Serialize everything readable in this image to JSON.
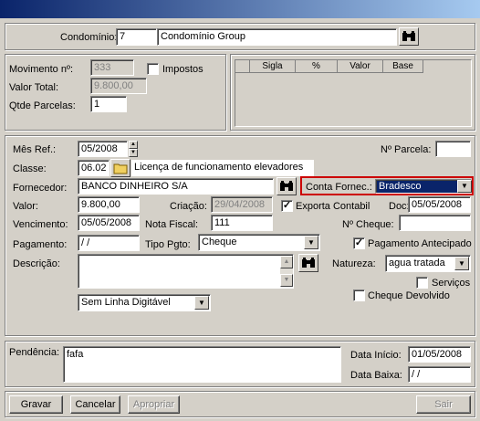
{
  "header": {
    "condominio_label": "Condomínio:",
    "condominio_code": "7",
    "condominio_name": "Condomínio Group",
    "search_icon": "binoculars-icon"
  },
  "movimento": {
    "movimento_label": "Movimento nº:",
    "movimento_value": "333",
    "impostos_label": "Impostos",
    "valor_total_label": "Valor Total:",
    "valor_total_value": "9.800,00",
    "parcelas_label": "Qtde Parcelas:",
    "parcelas_value": "1",
    "grid_columns": [
      "Sigla",
      "%",
      "Valor",
      "Base"
    ]
  },
  "detail": {
    "mes_ref_label": "Mês Ref.:",
    "mes_ref_value": "05/2008",
    "parcela_label": "Nº Parcela:",
    "parcela_value": "",
    "classe_label": "Classe:",
    "classe_code": "06.02",
    "classe_desc": "Licença de funcionamento elevadores",
    "fornecedor_label": "Fornecedor:",
    "fornecedor_value": "BANCO DINHEIRO S/A",
    "conta_label": "Conta Fornec.:",
    "conta_value": "Bradesco",
    "valor_label": "Valor:",
    "valor_value": "9.800,00",
    "criacao_label": "Criação:",
    "criacao_value": "29/04/2008",
    "exporta_label": "Exporta Contabil",
    "doc_label": "Doc:",
    "doc_value": "05/05/2008",
    "vencimento_label": "Vencimento:",
    "vencimento_value": "05/05/2008",
    "nota_label": "Nota Fiscal:",
    "nota_value": "111",
    "cheque_label": "Nº Cheque:",
    "cheque_value": "",
    "pagamento_label": "Pagamento:",
    "pagamento_value": " / /",
    "tipo_label": "Tipo Pgto:",
    "tipo_value": "Cheque",
    "antecipado_label": "Pagamento Antecipado",
    "descricao_label": "Descrição:",
    "descricao_value": "",
    "natureza_label": "Natureza:",
    "natureza_value": "agua tratada",
    "servicos_label": "Serviços",
    "cheque_devolvido_label": "Cheque Devolvido",
    "linha_value": "Sem Linha Digitável",
    "highlight_color": "#cc0000",
    "selection_color": "#0a246a"
  },
  "pendencia": {
    "label": "Pendência:",
    "value": "fafa",
    "data_inicio_label": "Data Início:",
    "data_inicio_value": "01/05/2008",
    "data_baixa_label": "Data Baixa:",
    "data_baixa_value": " / /"
  },
  "buttons": {
    "gravar": "Gravar",
    "cancelar": "Cancelar",
    "apropriar": "Apropriar",
    "sair": "Sair"
  }
}
